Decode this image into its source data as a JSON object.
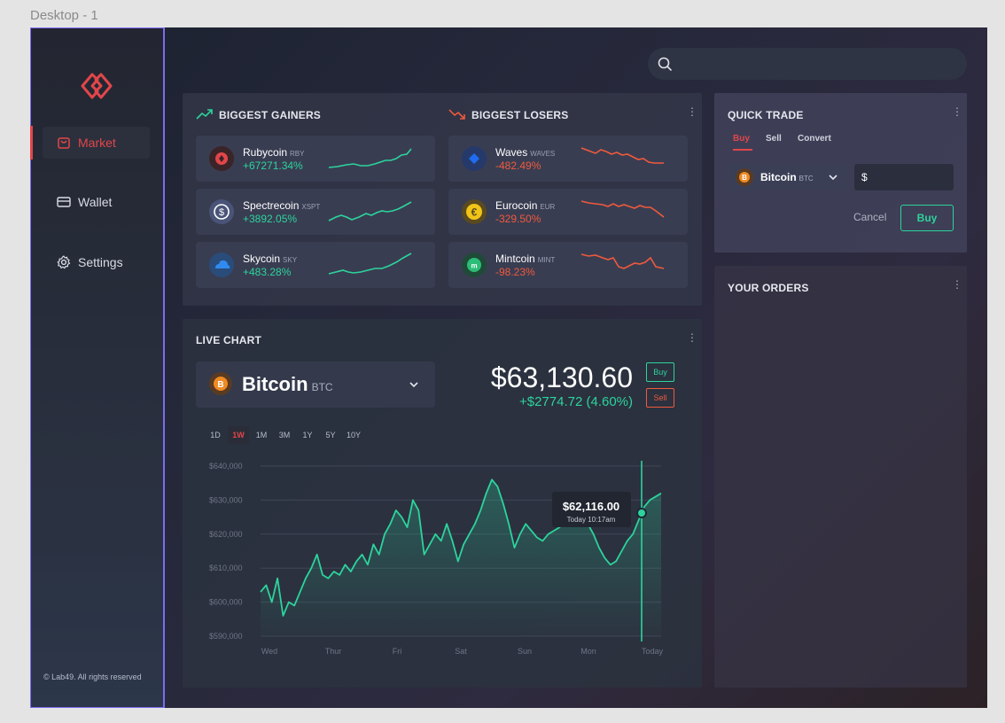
{
  "frame_label": "Desktop - 1",
  "sidebar": {
    "items": [
      {
        "label": "Market",
        "icon": "shopping-bag-icon",
        "active": true
      },
      {
        "label": "Wallet",
        "icon": "credit-card-icon",
        "active": false
      },
      {
        "label": "Settings",
        "icon": "gear-icon",
        "active": false
      }
    ],
    "copyright": "© Lab49. All rights reserved"
  },
  "search": {
    "icon": "search-icon",
    "placeholder": ""
  },
  "gainers": {
    "title": "BIGGEST GAINERS",
    "icon": "trending-up-icon",
    "items": [
      {
        "name": "Rubycoin",
        "ticker": "RBY",
        "change": "+67271.34%",
        "color": "#e2464a"
      },
      {
        "name": "Spectrecoin",
        "ticker": "XSPT",
        "change": "+3892.05%",
        "color": "#4a5a8a"
      },
      {
        "name": "Skycoin",
        "ticker": "SKY",
        "change": "+483.28%",
        "color": "#2f7fd9"
      }
    ]
  },
  "losers": {
    "title": "BIGGEST LOSERS",
    "icon": "trending-down-icon",
    "items": [
      {
        "name": "Waves",
        "ticker": "WAVES",
        "change": "-482.49%",
        "color": "#1f6cf0"
      },
      {
        "name": "Eurocoin",
        "ticker": "EUR",
        "change": "-329.50%",
        "color": "#f0c419"
      },
      {
        "name": "Mintcoin",
        "ticker": "MINT",
        "change": "-98.23%",
        "color": "#2cbd77"
      }
    ]
  },
  "live_chart": {
    "title": "LIVE CHART",
    "coin_name": "Bitcoin",
    "coin_ticker": "BTC",
    "price": "$63,130.60",
    "change": "+$2774.72 (4.60%)",
    "buy_label": "Buy",
    "sell_label": "Sell",
    "ranges": [
      "1D",
      "1W",
      "1M",
      "3M",
      "1Y",
      "5Y",
      "10Y"
    ],
    "selected_range": "1W",
    "y_ticks": [
      "$640,000",
      "$630,000",
      "$620,000",
      "$610,000",
      "$600,000",
      "$590,000"
    ],
    "x_ticks": [
      "Wed",
      "Thur",
      "Fri",
      "Sat",
      "Sun",
      "Mon",
      "Today"
    ],
    "tooltip_price": "$62,116.00",
    "tooltip_time": "Today 10:17am",
    "accent": "#2cd49c"
  },
  "chart_data": {
    "type": "area",
    "title": "LIVE CHART",
    "xlabel": "",
    "ylabel": "",
    "ylim": [
      590000,
      640000
    ],
    "x_categories": [
      "Wed",
      "Thur",
      "Fri",
      "Sat",
      "Sun",
      "Mon",
      "Today"
    ],
    "series": [
      {
        "values": [
          603000,
          605000,
          600000,
          607000,
          596000,
          600000,
          599000,
          603000,
          607000,
          610000,
          614000,
          608000,
          607000,
          609000,
          608000,
          611000,
          609000,
          612000,
          614000,
          611000,
          617000,
          614000,
          620000,
          623000,
          627000,
          625000,
          622000,
          630000,
          627000,
          614000,
          617000,
          620000,
          618000,
          623000,
          618000,
          612000,
          617000,
          620000,
          623000,
          627000,
          632000,
          636000,
          634000,
          629000,
          623000,
          616000,
          620000,
          623000,
          621000,
          619000,
          618000,
          620000,
          621000,
          622000,
          624000,
          626000,
          625000,
          627000,
          623000,
          620000,
          616000,
          613000,
          611000,
          612000,
          615000,
          618000,
          620000,
          624000,
          628000,
          630000,
          631000,
          632000
        ]
      }
    ],
    "tooltip": {
      "label": "$62,116.00",
      "time": "Today 10:17am"
    }
  },
  "quick_trade": {
    "title": "QUICK TRADE",
    "tabs": [
      "Buy",
      "Sell",
      "Convert"
    ],
    "selected_tab": "Buy",
    "coin_name": "Bitcoin",
    "coin_ticker": "BTC",
    "amount_prefix": "$",
    "cancel_label": "Cancel",
    "buy_label": "Buy"
  },
  "orders": {
    "title": "YOUR ORDERS"
  },
  "kebab": "⋮"
}
